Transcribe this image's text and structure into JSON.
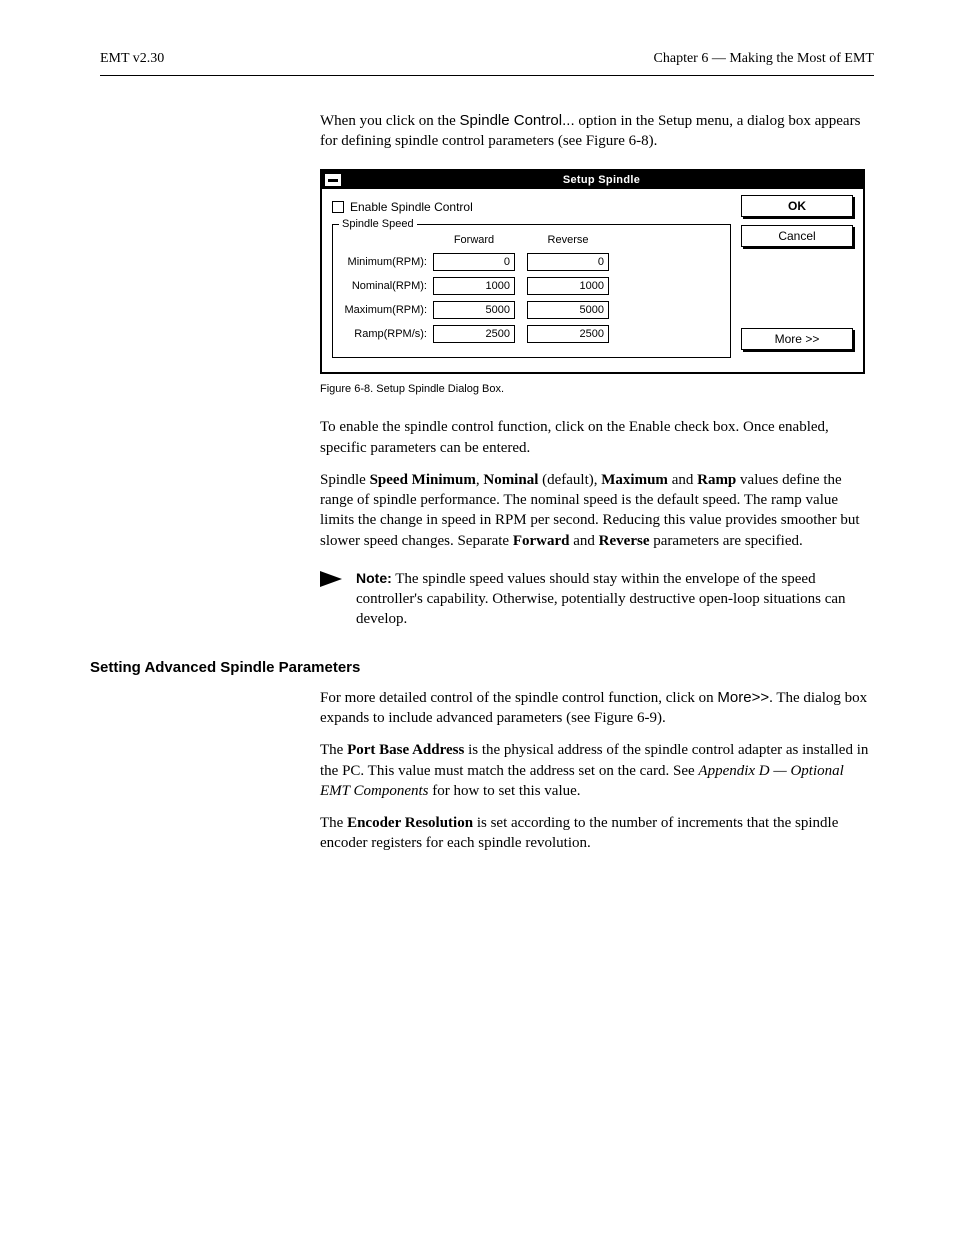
{
  "header": {
    "left": "EMT v2.30",
    "right": "Chapter 6 — Making the Most of EMT"
  },
  "para1_pre": "When you click on the ",
  "para1_opt": "Spindle Control...",
  "para1_post": " option in the Setup menu, a dialog box appears for defining spindle control parameters (see Figure 6-8).",
  "dialog": {
    "title": "Setup Spindle",
    "checkbox_label": "Enable Spindle Control",
    "group_legend": "Spindle Speed",
    "col_forward": "Forward",
    "col_reverse": "Reverse",
    "rows": [
      {
        "label": "Minimum(RPM):",
        "fwd": "0",
        "rev": "0"
      },
      {
        "label": "Nominal(RPM):",
        "fwd": "1000",
        "rev": "1000"
      },
      {
        "label": "Maximum(RPM):",
        "fwd": "5000",
        "rev": "5000"
      },
      {
        "label": "Ramp(RPM/s):",
        "fwd": "2500",
        "rev": "2500"
      }
    ],
    "buttons": {
      "ok": "OK",
      "cancel": "Cancel",
      "more": "More >>"
    }
  },
  "fig_caption": "Figure 6-8. Setup Spindle Dialog Box.",
  "para2": "To enable the spindle control function, click on the Enable check box. Once enabled, specific parameters can be entered.",
  "para3_pre": "Spindle ",
  "para3_b1": "Speed Minimum",
  "para3_mid1": ", ",
  "para3_b2": "Nominal",
  "para3_mid2": " (default), ",
  "para3_b3": "Maximum",
  "para3_mid3": " and ",
  "para3_b4": "Ramp",
  "para3_post": " values define the range of spindle performance. The nominal speed is the default speed. The ramp value limits the change in speed in RPM per second. Reducing this value provides smoother but slower speed changes. Separate ",
  "para3_b5": "Forward",
  "para3_mid4": " and ",
  "para3_b6": "Reverse",
  "para3_end": " parameters are specified.",
  "note_label": "Note:",
  "note_text": "The spindle speed values should stay within the envelope of the speed controller's capability. Otherwise, potentially destructive open-loop situations can develop.",
  "heading": "Setting Advanced Spindle Parameters",
  "para4_pre": "For more detailed control of the spindle control function, click on ",
  "para4_btn": "More>>",
  "para4_post": ". The dialog box expands to include advanced parameters (see Figure 6-9).",
  "para5_pre": "The ",
  "para5_b1": "Port Base Address",
  "para5_mid": " is the physical address of the spindle control adapter as installed in the PC. This value must match the address set on the card. See ",
  "para5_i": "Appendix D — Optional EMT Components",
  "para5_end": " for how to set this value.",
  "para6_pre": "The ",
  "para6_b": "Encoder Resolution",
  "para6_post": " is set according to the number of increments that the spindle encoder registers for each spindle revolution."
}
